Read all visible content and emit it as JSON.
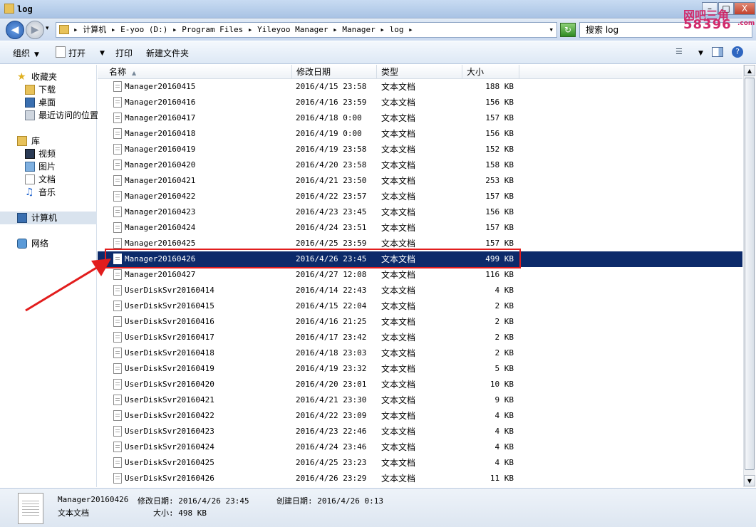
{
  "window": {
    "title": "log",
    "min_label": "–",
    "max_label": "□",
    "close_label": "X"
  },
  "address": {
    "path": "▸ 计算机 ▸ E-yoo (D:) ▸ Program Files ▸ Yileyoo Manager ▸ Manager ▸ log ▸",
    "dropdown_icon": "▾"
  },
  "search": {
    "placeholder": "搜索 log"
  },
  "watermark": {
    "line1": "网吧三角",
    "line2": "58396",
    "suffix": ".com"
  },
  "toolbar": {
    "organize": "组织",
    "open": "打开",
    "print": "打印",
    "new_folder": "新建文件夹"
  },
  "sidebar": {
    "favorites": "收藏夹",
    "downloads": "下载",
    "desktop": "桌面",
    "recent": "最近访问的位置",
    "libraries": "库",
    "videos": "视频",
    "pictures": "图片",
    "documents": "文档",
    "music": "音乐",
    "computer": "计算机",
    "network": "网络"
  },
  "columns": {
    "name": "名称",
    "date": "修改日期",
    "type": "类型",
    "size": "大小"
  },
  "files": [
    {
      "name": "Manager20160415",
      "date": "2016/4/15 23:58",
      "type": "文本文档",
      "size": "188 KB"
    },
    {
      "name": "Manager20160416",
      "date": "2016/4/16 23:59",
      "type": "文本文档",
      "size": "156 KB"
    },
    {
      "name": "Manager20160417",
      "date": "2016/4/18 0:00",
      "type": "文本文档",
      "size": "157 KB"
    },
    {
      "name": "Manager20160418",
      "date": "2016/4/19 0:00",
      "type": "文本文档",
      "size": "156 KB"
    },
    {
      "name": "Manager20160419",
      "date": "2016/4/19 23:58",
      "type": "文本文档",
      "size": "152 KB"
    },
    {
      "name": "Manager20160420",
      "date": "2016/4/20 23:58",
      "type": "文本文档",
      "size": "158 KB"
    },
    {
      "name": "Manager20160421",
      "date": "2016/4/21 23:50",
      "type": "文本文档",
      "size": "253 KB"
    },
    {
      "name": "Manager20160422",
      "date": "2016/4/22 23:57",
      "type": "文本文档",
      "size": "157 KB"
    },
    {
      "name": "Manager20160423",
      "date": "2016/4/23 23:45",
      "type": "文本文档",
      "size": "156 KB"
    },
    {
      "name": "Manager20160424",
      "date": "2016/4/24 23:51",
      "type": "文本文档",
      "size": "157 KB"
    },
    {
      "name": "Manager20160425",
      "date": "2016/4/25 23:59",
      "type": "文本文档",
      "size": "157 KB"
    },
    {
      "name": "Manager20160426",
      "date": "2016/4/26 23:45",
      "type": "文本文档",
      "size": "499 KB",
      "selected": true
    },
    {
      "name": "Manager20160427",
      "date": "2016/4/27 12:08",
      "type": "文本文档",
      "size": "116 KB"
    },
    {
      "name": "UserDiskSvr20160414",
      "date": "2016/4/14 22:43",
      "type": "文本文档",
      "size": "4 KB"
    },
    {
      "name": "UserDiskSvr20160415",
      "date": "2016/4/15 22:04",
      "type": "文本文档",
      "size": "2 KB"
    },
    {
      "name": "UserDiskSvr20160416",
      "date": "2016/4/16 21:25",
      "type": "文本文档",
      "size": "2 KB"
    },
    {
      "name": "UserDiskSvr20160417",
      "date": "2016/4/17 23:42",
      "type": "文本文档",
      "size": "2 KB"
    },
    {
      "name": "UserDiskSvr20160418",
      "date": "2016/4/18 23:03",
      "type": "文本文档",
      "size": "2 KB"
    },
    {
      "name": "UserDiskSvr20160419",
      "date": "2016/4/19 23:32",
      "type": "文本文档",
      "size": "5 KB"
    },
    {
      "name": "UserDiskSvr20160420",
      "date": "2016/4/20 23:01",
      "type": "文本文档",
      "size": "10 KB"
    },
    {
      "name": "UserDiskSvr20160421",
      "date": "2016/4/21 23:30",
      "type": "文本文档",
      "size": "9 KB"
    },
    {
      "name": "UserDiskSvr20160422",
      "date": "2016/4/22 23:09",
      "type": "文本文档",
      "size": "4 KB"
    },
    {
      "name": "UserDiskSvr20160423",
      "date": "2016/4/23 22:46",
      "type": "文本文档",
      "size": "4 KB"
    },
    {
      "name": "UserDiskSvr20160424",
      "date": "2016/4/24 23:46",
      "type": "文本文档",
      "size": "4 KB"
    },
    {
      "name": "UserDiskSvr20160425",
      "date": "2016/4/25 23:23",
      "type": "文本文档",
      "size": "4 KB"
    },
    {
      "name": "UserDiskSvr20160426",
      "date": "2016/4/26 23:29",
      "type": "文本文档",
      "size": "11 KB"
    }
  ],
  "details": {
    "filename": "Manager20160426",
    "modified": "修改日期: 2016/4/26 23:45",
    "created": "创建日期: 2016/4/26 0:13",
    "type": "文本文档",
    "size": "大小: 498 KB"
  },
  "colors": {
    "selection": "#0c2a6a",
    "highlight_border": "#e21d1d",
    "arrow": "#e21d1d"
  }
}
